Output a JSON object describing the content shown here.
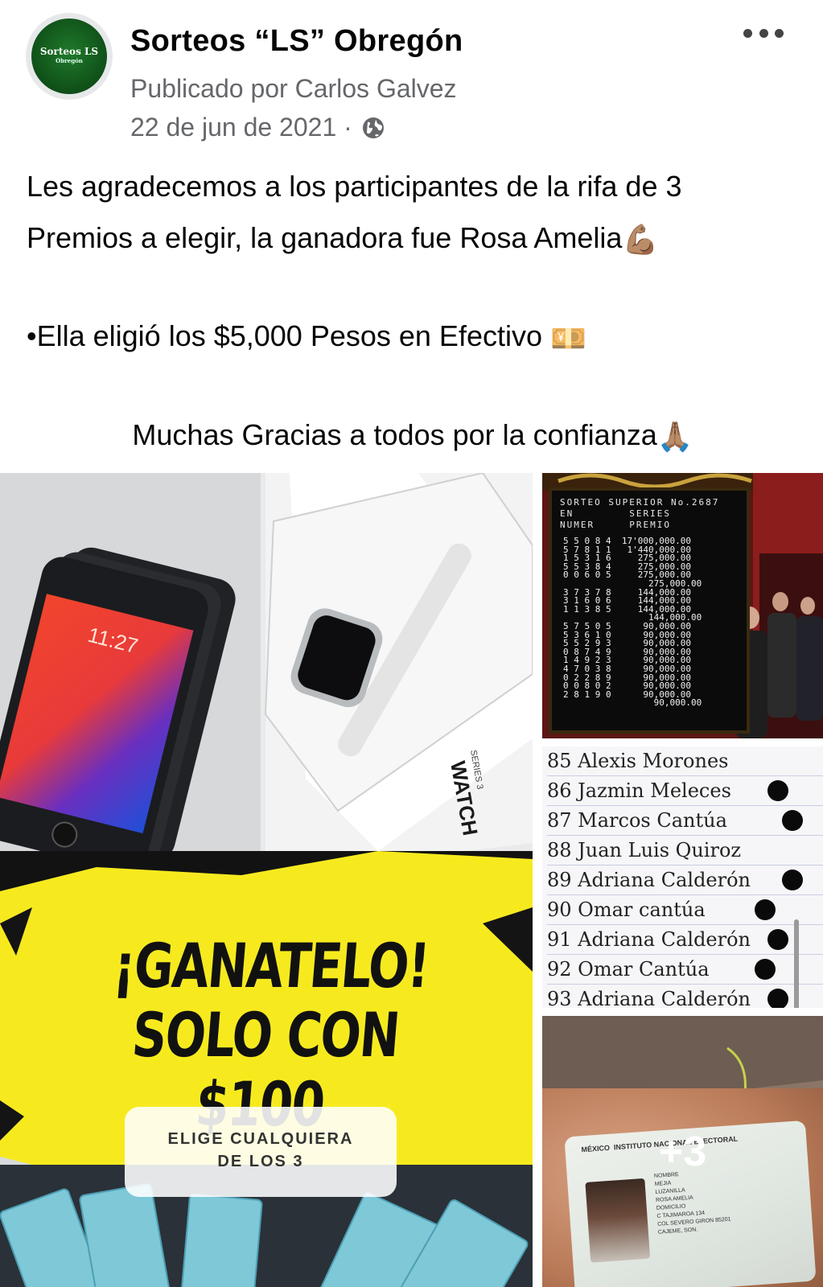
{
  "post": {
    "page_name": "Sorteos “LS” Obregón",
    "avatar_text": "Sorteos LS",
    "avatar_subtext": "Obregón",
    "posted_by": "Publicado por Carlos Galvez",
    "date": "22 de jun de 2021 ·",
    "privacy_icon": "globe-icon",
    "more_icon": "more-options-icon",
    "text": {
      "line1": "Les agradecemos a los participantes de la rifa de 3",
      "line2": "Premios a elegir, la ganadora fue Rosa Amelia",
      "line2_emoji": "💪🏽",
      "line3": "•Ella eligió los $5,000 Pesos en Efectivo ",
      "line3_emoji": "💴",
      "line4": "Muchas Gracias a todos por la confianza",
      "line4_emoji": "🙏🏽"
    }
  },
  "media": {
    "main": {
      "phone_time": "11:27",
      "watch_label": "WATCH",
      "watch_series": "SERIES 3",
      "promo_line1": "¡GANATELO!",
      "promo_line2": "SOLO CON $100",
      "choice_line1": "ELIGE CUALQUIERA",
      "choice_line2": "DE LOS 3"
    },
    "lottery": {
      "header_line1": "SORTEO SUPERIOR No.2687",
      "header_line2": "EN        SERIES",
      "header_line3": "NUMER     PREMIO",
      "rows": "5 5 0 8 4  17'000,000.00\n5 7 8 1 1   1'440,000.00\n1 5 3 1 6     275,000.00\n5 5 3 8 4     275,000.00\n0 0 6 0 5     275,000.00\n                275,000.00\n3 7 3 7 8     144,000.00\n3 1 6 0 6     144,000.00\n1 1 3 8 5     144,000.00\n                144,000.00\n5 7 5 0 5      90,000.00\n5 3 6 1 0      90,000.00\n5 5 2 9 3      90,000.00\n0 8 7 4 9      90,000.00\n1 4 9 2 3      90,000.00\n4 7 0 3 8      90,000.00\n0 2 2 8 9      90,000.00\n0 0 8 0 2      90,000.00\n2 8 1 9 0      90,000.00\n                 90,000.00"
    },
    "participants": [
      {
        "label": "85 Alexis Morones",
        "dot": false
      },
      {
        "label": "86 Jazmin Meleces",
        "dot": true,
        "dot_pos": "r1"
      },
      {
        "label": "87 Marcos Cantúa",
        "dot": true,
        "dot_pos": "r2"
      },
      {
        "label": "88 Juan Luis Quiroz",
        "dot": false
      },
      {
        "label": "89 Adriana Calderón",
        "dot": true,
        "dot_pos": "r2"
      },
      {
        "label": "90 Omar cantúa",
        "dot": true,
        "dot_pos": "r0"
      },
      {
        "label": "91 Adriana Calderón",
        "dot": true,
        "dot_pos": "r1"
      },
      {
        "label": "92 Omar Cantúa",
        "dot": true,
        "dot_pos": "r0"
      },
      {
        "label": "93 Adriana Calderón",
        "dot": true,
        "dot_pos": "r1"
      }
    ],
    "id_card": {
      "header": "INSTITUTO NACIONAL ELECTORAL",
      "country": "MÉXICO",
      "lines": [
        "NOMBRE",
        "MEJIA",
        "LUZANILLA",
        "ROSA AMELIA",
        "DOMICILIO",
        "C TAJIMAROA 134",
        "COL SEVERO GIRON 85201",
        "CAJEME, SON."
      ]
    },
    "more_photos_label": "+3"
  },
  "colors": {
    "text": "#050505",
    "secondary_text": "#65676b",
    "promo_yellow": "#f6ea1f",
    "avatar_green": "#0f4f18"
  }
}
